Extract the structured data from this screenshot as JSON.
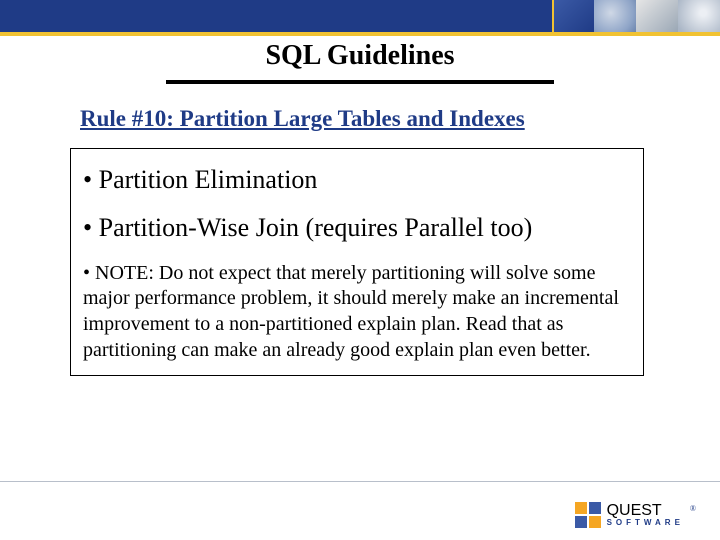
{
  "title": "SQL Guidelines",
  "rule_heading": "Rule #10: Partition Large Tables and Indexes",
  "bullets": {
    "b1": "• Partition Elimination",
    "b2": "• Partition-Wise Join (requires Parallel too)"
  },
  "note": "• NOTE: Do not expect that merely partitioning will solve some major performance problem, it should merely make an incremental improvement to a non-partitioned explain plan. Read that as partitioning can make an already good explain plan even better.",
  "logo": {
    "top": "QUEST",
    "bottom": "SOFTWARE",
    "reg": "®"
  }
}
